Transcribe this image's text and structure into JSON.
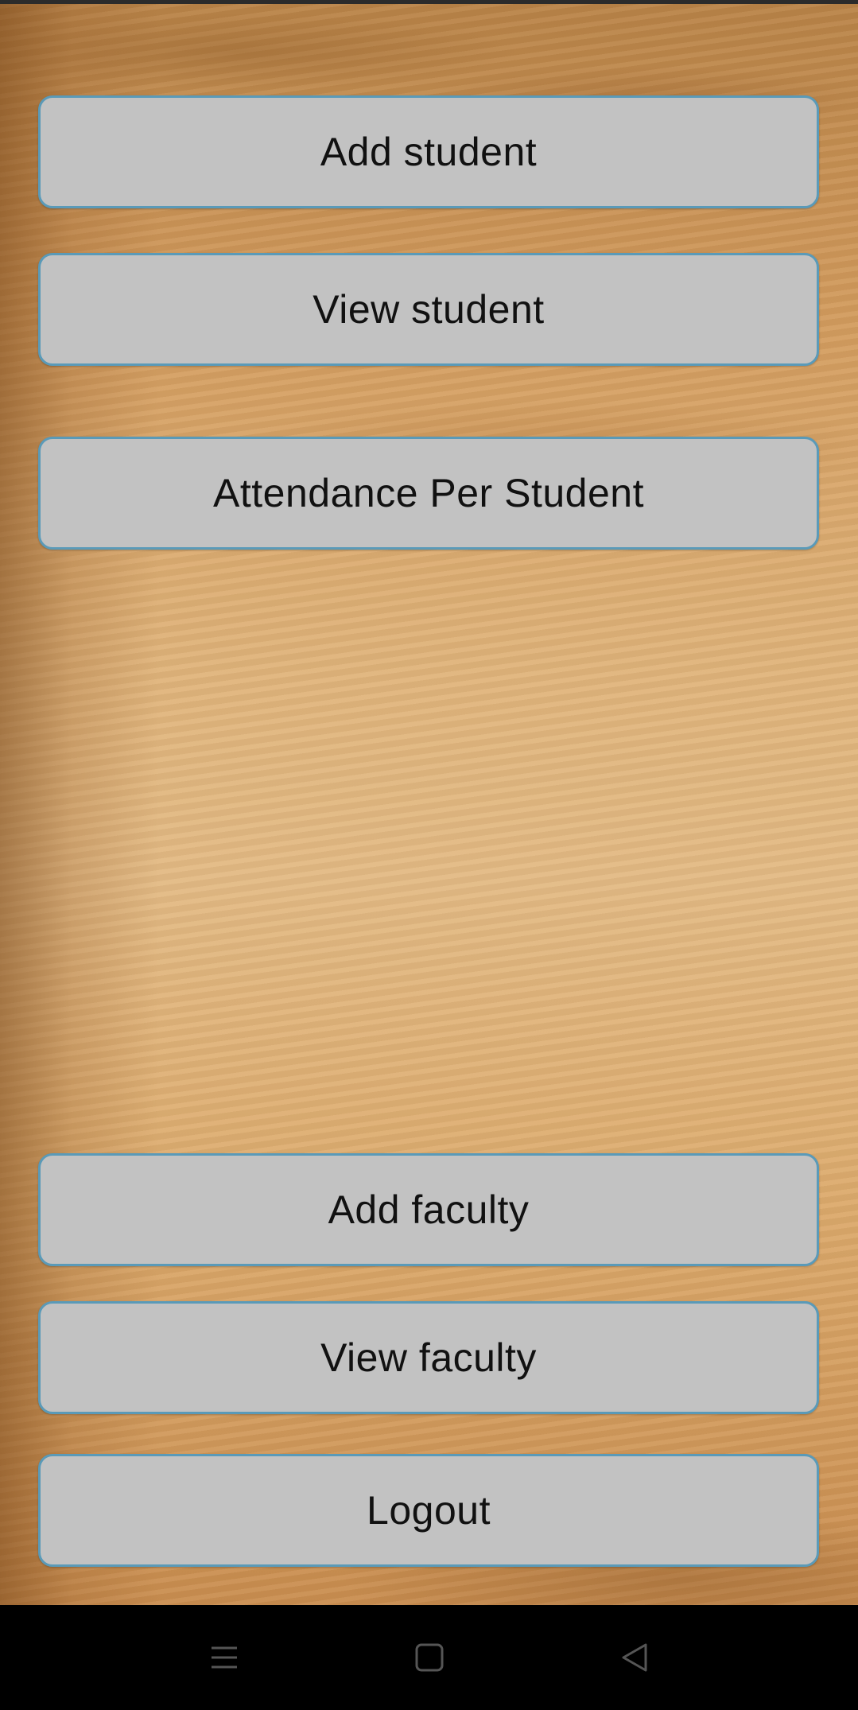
{
  "buttons": {
    "add_student": "Add student",
    "view_student": "View student",
    "attendance_per_student": "Attendance Per Student",
    "add_faculty": "Add faculty",
    "view_faculty": "View faculty",
    "logout": "Logout"
  },
  "navigation_bar": {
    "icons": [
      "menu-icon",
      "home-icon",
      "back-icon"
    ]
  },
  "colors": {
    "button_fill": "#c2c2c2",
    "button_border": "#5a9ab8",
    "background_wood": "#dcaa6c",
    "nav_bar": "#000000"
  }
}
